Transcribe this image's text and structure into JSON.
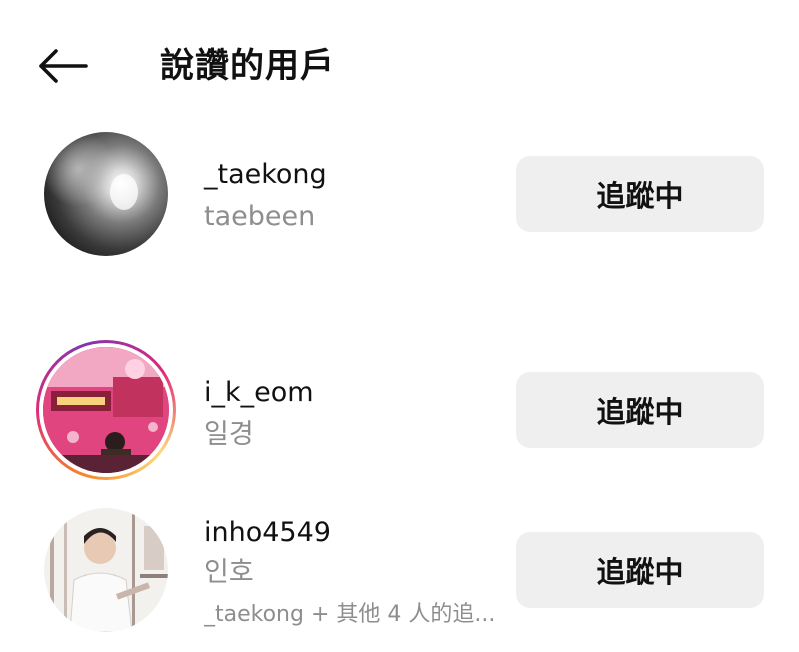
{
  "header": {
    "title": "說讚的用戶",
    "back_icon": "arrow-left-icon"
  },
  "users": [
    {
      "username": "_taekong",
      "full_name": "taebeen",
      "button_label": "追蹤中",
      "has_story_ring": false
    },
    {
      "username": "i_k_eom",
      "full_name": "일경",
      "button_label": "追蹤中",
      "has_story_ring": true
    },
    {
      "username": "inho4549",
      "full_name": "인호",
      "mutual": "_taekong + 其他 4 人的追...",
      "button_label": "追蹤中",
      "has_story_ring": false
    }
  ],
  "colors": {
    "button_bg": "#efefef",
    "secondary_text": "#8e8e8e",
    "story_ring": [
      "#f58529",
      "#dd2a7b",
      "#8134af",
      "#feda77"
    ]
  }
}
